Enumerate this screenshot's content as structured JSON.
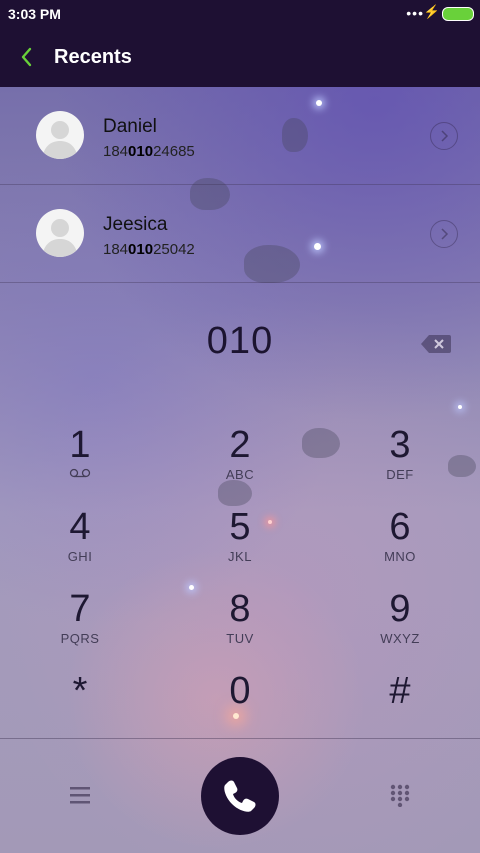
{
  "status_bar": {
    "time": "3:03 PM",
    "more_dots": "•••",
    "charging": "⚡",
    "battery_color": "#69d13a"
  },
  "header": {
    "back_icon": "chevron-left-icon",
    "title": "Recents"
  },
  "contacts": [
    {
      "name": "Daniel",
      "number_pre": "184",
      "number_match": "010",
      "number_post": "24685"
    },
    {
      "name": "Jeesica",
      "number_pre": "184",
      "number_match": "010",
      "number_post": "25042"
    }
  ],
  "dial_input": {
    "value": "010",
    "backspace_icon": "backspace-icon"
  },
  "keypad": [
    {
      "digit": "1",
      "letters": "⌂",
      "icon": "voicemail-icon"
    },
    {
      "digit": "2",
      "letters": "ABC"
    },
    {
      "digit": "3",
      "letters": "DEF"
    },
    {
      "digit": "4",
      "letters": "GHI"
    },
    {
      "digit": "5",
      "letters": "JKL"
    },
    {
      "digit": "6",
      "letters": "MNO"
    },
    {
      "digit": "7",
      "letters": "PQRS"
    },
    {
      "digit": "8",
      "letters": "TUV"
    },
    {
      "digit": "9",
      "letters": "WXYZ"
    },
    {
      "digit": "*",
      "letters": ""
    },
    {
      "digit": "0",
      "letters": ""
    },
    {
      "digit": "#",
      "letters": ""
    }
  ],
  "bottom_bar": {
    "menu_icon": "menu-icon",
    "call_icon": "phone-icon",
    "keypad_icon": "keypad-icon"
  },
  "colors": {
    "bar_background": "#1e1033",
    "accent_green": "#69d13a"
  }
}
